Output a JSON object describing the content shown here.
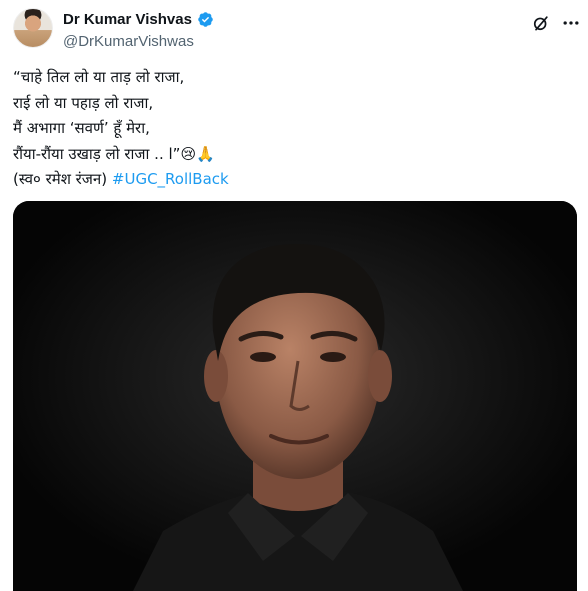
{
  "author": {
    "display_name": "Dr Kumar Vishvas",
    "handle": "@DrKumarVishwas",
    "verified": true,
    "avatar_icon": "avatar-photo"
  },
  "header_icons": {
    "grok": "grok-icon",
    "more": "more-icon"
  },
  "tweet": {
    "lines": [
      "“चाहे तिल लो या ताड़ लो राजा,",
      "राई लो या पहाड़ लो राजा,",
      "मैं अभागा ‘सवर्ण’ हूँ मेरा,",
      "रौंया-रौंया उखाड़ लो राजा .. l”"
    ],
    "emojis": [
      "😢",
      "🙏"
    ],
    "credit": "(स्व० रमेश रंजन)",
    "hashtag": "#UGC_RollBack"
  },
  "colors": {
    "accent": "#1d9bf0",
    "text": "#0f1419",
    "muted": "#536471"
  }
}
